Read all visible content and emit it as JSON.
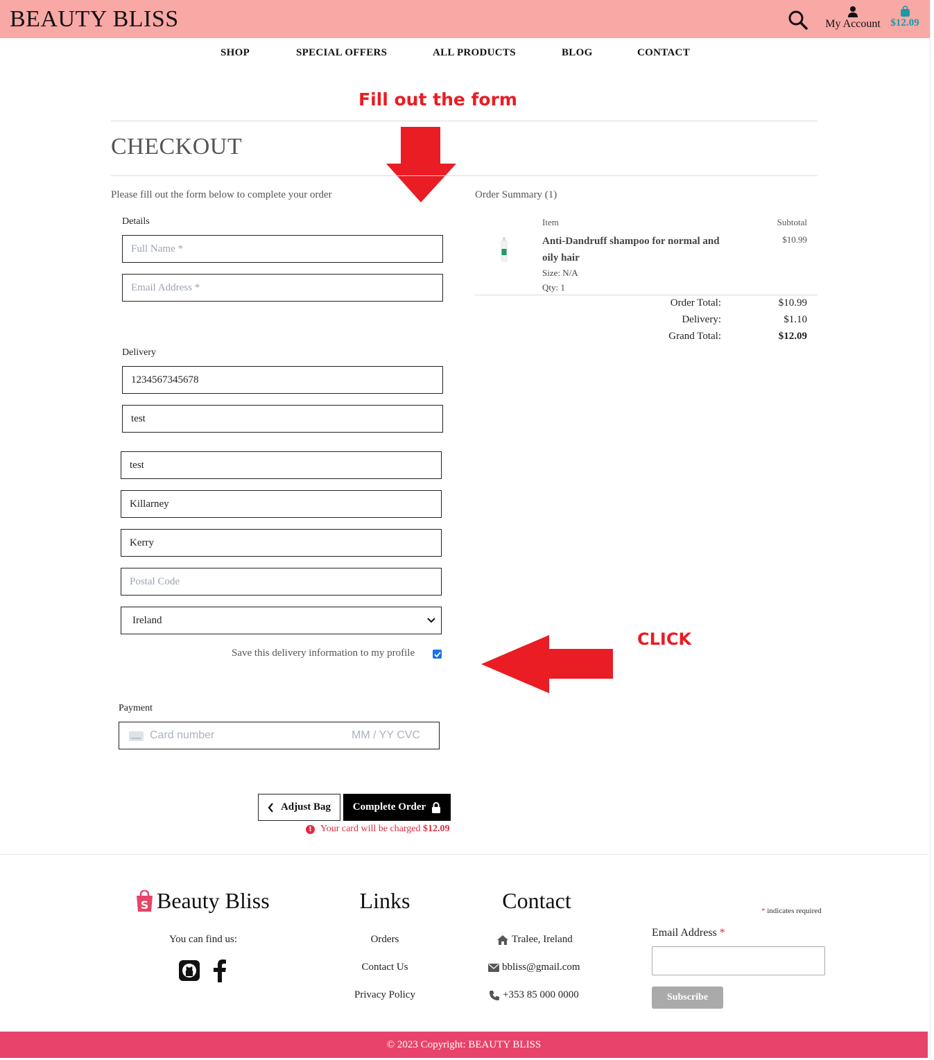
{
  "header": {
    "brand": "BEAUTY BLISS",
    "account_label": "My Account",
    "bag_total": "$12.09",
    "bg_color": "#f8a8a5"
  },
  "nav": [
    "SHOP",
    "SPECIAL OFFERS",
    "ALL PRODUCTS",
    "BLOG",
    "CONTACT"
  ],
  "annotations": {
    "fill_form": "Fill out the form",
    "click": "CLICK",
    "color": "#ea1c24"
  },
  "checkout": {
    "title": "CHECKOUT",
    "intro": "Please fill out the form below to complete your order",
    "details_label": "Details",
    "full_name_placeholder": "Full Name *",
    "email_placeholder": "Email Address *",
    "delivery_label": "Delivery",
    "phone": "1234567345678",
    "address1": "test",
    "address2": "test",
    "town": "Killarney",
    "county": "Kerry",
    "postcode_placeholder": "Postal Code",
    "country": "Ireland",
    "save_info_label": "Save this delivery information to my profile",
    "save_info_checked": true,
    "payment_label": "Payment",
    "card_placeholder": "Card number",
    "card_exp_cvc": "MM / YY  CVC",
    "adjust_bag": "Adjust Bag",
    "complete_order": "Complete Order",
    "charge_text": "Your card will be charged",
    "charge_amount": "$12.09"
  },
  "order_summary": {
    "heading": "Order Summary (1)",
    "col_item": "Item",
    "col_subtotal": "Subtotal",
    "product_name": "Anti-Dandruff shampoo for normal and oily hair",
    "size": "Size: N/A",
    "qty": "Qty: 1",
    "subtotal": "$10.99",
    "order_total_label": "Order Total:",
    "order_total": "$10.99",
    "delivery_label": "Delivery:",
    "delivery": "$1.10",
    "grand_total_label": "Grand Total:",
    "grand_total": "$12.09"
  },
  "footer": {
    "brand": "Beauty Bliss",
    "find_us": "You can find us:",
    "links_heading": "Links",
    "links": [
      "Orders",
      "Contact Us",
      "Privacy Policy"
    ],
    "contact_heading": "Contact",
    "location": "Tralee, Ireland",
    "email": "bbliss@gmail.com",
    "phone": "+353 85 000 0000",
    "required_note": "indicates required",
    "email_label": "Email Address",
    "subscribe": "Subscribe",
    "copyright": "© 2023 Copyright: BEAUTY BLISS",
    "accent_color": "#e8436a"
  }
}
